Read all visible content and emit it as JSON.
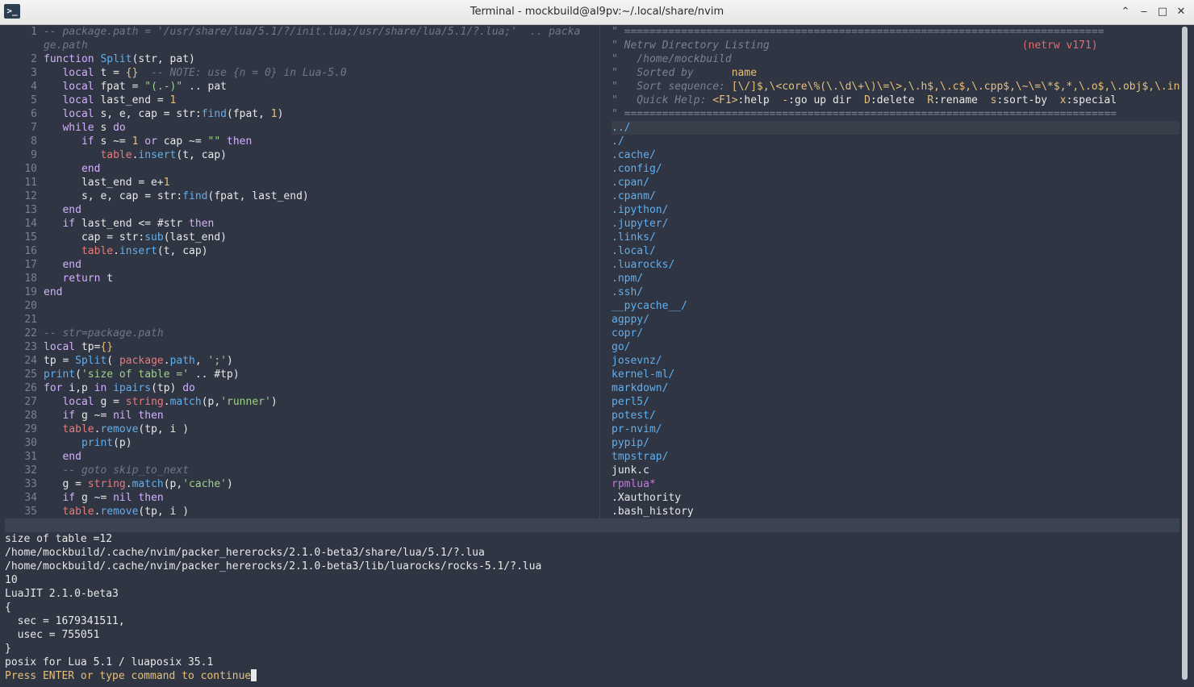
{
  "window": {
    "title": "Terminal - mockbuild@al9pv:~/.local/share/nvim",
    "app_icon_glyph": ">_",
    "controls": {
      "keep_above": "⌃",
      "minimize": "‒",
      "maximize": "□",
      "close": "✕"
    }
  },
  "editor": {
    "lines": [
      {
        "n": "1",
        "segs": [
          [
            "cmt",
            "-- package.path = '/usr/share/lua/5.1/?/init.lua;/usr/share/lua/5.1/?.lua;'  .. packa"
          ]
        ]
      },
      {
        "n": "",
        "segs": [
          [
            "cmt",
            "ge.path"
          ]
        ]
      },
      {
        "n": "2",
        "segs": [
          [
            "kw",
            "function "
          ],
          [
            "fn",
            "Split"
          ],
          [
            "def",
            "(str, pat)"
          ]
        ]
      },
      {
        "n": "3",
        "segs": [
          [
            "def",
            "   "
          ],
          [
            "kw",
            "local "
          ],
          [
            "def",
            "t = "
          ],
          [
            "brace",
            "{}"
          ],
          [
            "cmt",
            "  -- NOTE: use {n = 0} in Lua-5.0"
          ]
        ]
      },
      {
        "n": "4",
        "segs": [
          [
            "def",
            "   "
          ],
          [
            "kw",
            "local "
          ],
          [
            "def",
            "fpat = "
          ],
          [
            "str",
            "\"(.-)\""
          ],
          [
            "def",
            " .. pat"
          ]
        ]
      },
      {
        "n": "5",
        "segs": [
          [
            "def",
            "   "
          ],
          [
            "kw",
            "local "
          ],
          [
            "def",
            "last_end = "
          ],
          [
            "num",
            "1"
          ]
        ]
      },
      {
        "n": "6",
        "segs": [
          [
            "def",
            "   "
          ],
          [
            "kw",
            "local "
          ],
          [
            "def",
            "s, e, cap = str:"
          ],
          [
            "fn",
            "find"
          ],
          [
            "def",
            "(fpat, "
          ],
          [
            "num",
            "1"
          ],
          [
            "def",
            ")"
          ]
        ]
      },
      {
        "n": "7",
        "segs": [
          [
            "def",
            "   "
          ],
          [
            "kw",
            "while "
          ],
          [
            "def",
            "s "
          ],
          [
            "kw",
            "do"
          ]
        ]
      },
      {
        "n": "8",
        "segs": [
          [
            "def",
            "      "
          ],
          [
            "kw",
            "if "
          ],
          [
            "def",
            "s ~= "
          ],
          [
            "num",
            "1"
          ],
          [
            "kw",
            " or "
          ],
          [
            "def",
            "cap ~= "
          ],
          [
            "str",
            "\"\""
          ],
          [
            "kw",
            " then"
          ]
        ]
      },
      {
        "n": "9",
        "segs": [
          [
            "def",
            "         "
          ],
          [
            "red",
            "table"
          ],
          [
            "def",
            "."
          ],
          [
            "fn",
            "insert"
          ],
          [
            "def",
            "(t, cap)"
          ]
        ]
      },
      {
        "n": "10",
        "segs": [
          [
            "def",
            "      "
          ],
          [
            "kw",
            "end"
          ]
        ]
      },
      {
        "n": "11",
        "segs": [
          [
            "def",
            "      last_end = e+"
          ],
          [
            "num",
            "1"
          ]
        ]
      },
      {
        "n": "12",
        "segs": [
          [
            "def",
            "      s, e, cap = str:"
          ],
          [
            "fn",
            "find"
          ],
          [
            "def",
            "(fpat, last_end)"
          ]
        ]
      },
      {
        "n": "13",
        "segs": [
          [
            "def",
            "   "
          ],
          [
            "kw",
            "end"
          ]
        ]
      },
      {
        "n": "14",
        "segs": [
          [
            "def",
            "   "
          ],
          [
            "kw",
            "if "
          ],
          [
            "def",
            "last_end <= #str "
          ],
          [
            "kw",
            "then"
          ]
        ]
      },
      {
        "n": "15",
        "segs": [
          [
            "def",
            "      cap = str:"
          ],
          [
            "fn",
            "sub"
          ],
          [
            "def",
            "(last_end)"
          ]
        ]
      },
      {
        "n": "16",
        "segs": [
          [
            "def",
            "      "
          ],
          [
            "red",
            "table"
          ],
          [
            "def",
            "."
          ],
          [
            "fn",
            "insert"
          ],
          [
            "def",
            "(t, cap)"
          ]
        ]
      },
      {
        "n": "17",
        "segs": [
          [
            "def",
            "   "
          ],
          [
            "kw",
            "end"
          ]
        ]
      },
      {
        "n": "18",
        "segs": [
          [
            "def",
            "   "
          ],
          [
            "kw",
            "return "
          ],
          [
            "def",
            "t"
          ]
        ]
      },
      {
        "n": "19",
        "segs": [
          [
            "kw",
            "end"
          ]
        ]
      },
      {
        "n": "20",
        "segs": []
      },
      {
        "n": "21",
        "segs": []
      },
      {
        "n": "22",
        "segs": [
          [
            "cmt",
            "-- str=package.path"
          ]
        ]
      },
      {
        "n": "23",
        "segs": [
          [
            "kw",
            "local "
          ],
          [
            "def",
            "tp="
          ],
          [
            "brace",
            "{}"
          ]
        ]
      },
      {
        "n": "24",
        "segs": [
          [
            "def",
            "tp = "
          ],
          [
            "fn",
            "Split"
          ],
          [
            "def",
            "( "
          ],
          [
            "red",
            "package"
          ],
          [
            "def",
            "."
          ],
          [
            "fn",
            "path"
          ],
          [
            "def",
            ", "
          ],
          [
            "str",
            "';'"
          ],
          [
            "def",
            ")"
          ]
        ]
      },
      {
        "n": "25",
        "segs": [
          [
            "fn",
            "print"
          ],
          [
            "def",
            "("
          ],
          [
            "str",
            "'size of table ='"
          ],
          [
            "def",
            " .. #tp)"
          ]
        ]
      },
      {
        "n": "26",
        "segs": [
          [
            "kw",
            "for "
          ],
          [
            "def",
            "i,p "
          ],
          [
            "kw",
            "in "
          ],
          [
            "fn",
            "ipairs"
          ],
          [
            "def",
            "(tp) "
          ],
          [
            "kw",
            "do"
          ]
        ]
      },
      {
        "n": "27",
        "segs": [
          [
            "def",
            "   "
          ],
          [
            "kw",
            "local "
          ],
          [
            "def",
            "g = "
          ],
          [
            "red",
            "string"
          ],
          [
            "def",
            "."
          ],
          [
            "fn",
            "match"
          ],
          [
            "def",
            "(p,"
          ],
          [
            "str",
            "'runner'"
          ],
          [
            "def",
            ")"
          ]
        ]
      },
      {
        "n": "28",
        "segs": [
          [
            "def",
            "   "
          ],
          [
            "kw",
            "if "
          ],
          [
            "def",
            "g ~= "
          ],
          [
            "kw",
            "nil then"
          ]
        ]
      },
      {
        "n": "29",
        "segs": [
          [
            "def",
            "   "
          ],
          [
            "red",
            "table"
          ],
          [
            "def",
            "."
          ],
          [
            "fn",
            "remove"
          ],
          [
            "def",
            "(tp, i )"
          ]
        ]
      },
      {
        "n": "30",
        "segs": [
          [
            "def",
            "      "
          ],
          [
            "fn",
            "print"
          ],
          [
            "def",
            "(p)"
          ]
        ]
      },
      {
        "n": "31",
        "segs": [
          [
            "def",
            "   "
          ],
          [
            "kw",
            "end"
          ]
        ]
      },
      {
        "n": "32",
        "segs": [
          [
            "def",
            "   "
          ],
          [
            "cmt",
            "-- goto skip_to_next"
          ]
        ]
      },
      {
        "n": "33",
        "segs": [
          [
            "def",
            "   g = "
          ],
          [
            "red",
            "string"
          ],
          [
            "def",
            "."
          ],
          [
            "fn",
            "match"
          ],
          [
            "def",
            "(p,"
          ],
          [
            "str",
            "'cache'"
          ],
          [
            "def",
            ")"
          ]
        ]
      },
      {
        "n": "34",
        "segs": [
          [
            "def",
            "   "
          ],
          [
            "kw",
            "if "
          ],
          [
            "def",
            "g ~= "
          ],
          [
            "kw",
            "nil then"
          ]
        ]
      },
      {
        "n": "35",
        "segs": [
          [
            "def",
            "   "
          ],
          [
            "red",
            "table"
          ],
          [
            "def",
            "."
          ],
          [
            "fn",
            "remove"
          ],
          [
            "def",
            "(tp, i )"
          ]
        ]
      }
    ]
  },
  "netrw": {
    "header": [
      [
        [
          "hdr",
          "\" ============================================================================"
        ]
      ],
      [
        [
          "hdr",
          "\" Netrw Directory Listing                                        "
        ],
        [
          "red",
          "(netrw v171)"
        ]
      ],
      [
        [
          "hdr",
          "\"   /home/mockbuild"
        ]
      ],
      [
        [
          "hdr",
          "\"   Sorted by      "
        ],
        [
          "hl",
          "name"
        ]
      ],
      [
        [
          "hdr",
          "\"   Sort sequence: "
        ],
        [
          "hl",
          "[\\/]$,\\<core\\%(\\.\\d\\+\\)\\=\\>,\\.h$,\\.c$,\\.cpp$,\\~\\=\\*$,*,\\.o$,\\.obj$,\\.info$,"
        ]
      ],
      [
        [
          "hdr",
          "\"   Quick Help: "
        ],
        [
          "hl",
          "<F1>"
        ],
        [
          "file",
          ":help  "
        ],
        [
          "hl",
          "-"
        ],
        [
          "file",
          ":go up dir  "
        ],
        [
          "hl",
          "D"
        ],
        [
          "file",
          ":delete  "
        ],
        [
          "hl",
          "R"
        ],
        [
          "file",
          ":rename  "
        ],
        [
          "hl",
          "s"
        ],
        [
          "file",
          ":sort-by  "
        ],
        [
          "hl",
          "x"
        ],
        [
          "file",
          ":special"
        ]
      ],
      [
        [
          "hdr",
          "\" =============================================================================="
        ]
      ]
    ],
    "entries": [
      {
        "name": "../",
        "kind": "dir"
      },
      {
        "name": "./",
        "kind": "dir"
      },
      {
        "name": ".cache/",
        "kind": "dir"
      },
      {
        "name": ".config/",
        "kind": "dir"
      },
      {
        "name": ".cpan/",
        "kind": "dir"
      },
      {
        "name": ".cpanm/",
        "kind": "dir"
      },
      {
        "name": ".ipython/",
        "kind": "dir"
      },
      {
        "name": ".jupyter/",
        "kind": "dir"
      },
      {
        "name": ".links/",
        "kind": "dir"
      },
      {
        "name": ".local/",
        "kind": "dir"
      },
      {
        "name": ".luarocks/",
        "kind": "dir"
      },
      {
        "name": ".npm/",
        "kind": "dir"
      },
      {
        "name": ".ssh/",
        "kind": "dir"
      },
      {
        "name": "__pycache__/",
        "kind": "dir"
      },
      {
        "name": "agppy/",
        "kind": "dir"
      },
      {
        "name": "copr/",
        "kind": "dir"
      },
      {
        "name": "go/",
        "kind": "dir"
      },
      {
        "name": "josevnz/",
        "kind": "dir"
      },
      {
        "name": "kernel-ml/",
        "kind": "dir"
      },
      {
        "name": "markdown/",
        "kind": "dir"
      },
      {
        "name": "perl5/",
        "kind": "dir"
      },
      {
        "name": "potest/",
        "kind": "dir"
      },
      {
        "name": "pr-nvim/",
        "kind": "dir"
      },
      {
        "name": "pypip/",
        "kind": "dir"
      },
      {
        "name": "tmpstrap/",
        "kind": "dir"
      },
      {
        "name": "junk.c",
        "kind": "file"
      },
      {
        "name": "rpmlua*",
        "kind": "exe"
      },
      {
        "name": ".Xauthority",
        "kind": "file"
      },
      {
        "name": ".bash_history",
        "kind": "file"
      }
    ]
  },
  "output": {
    "lines": [
      "size of table =12",
      "/home/mockbuild/.cache/nvim/packer_hererocks/2.1.0-beta3/share/lua/5.1/?.lua",
      "/home/mockbuild/.cache/nvim/packer_hererocks/2.1.0-beta3/lib/luarocks/rocks-5.1/?.lua",
      "10",
      "LuaJIT 2.1.0-beta3",
      "{",
      "  sec = 1679341511,",
      "  usec = 755051",
      "}",
      "posix for Lua 5.1 / luaposix 35.1"
    ],
    "prompt": "Press ENTER or type command to continue"
  }
}
